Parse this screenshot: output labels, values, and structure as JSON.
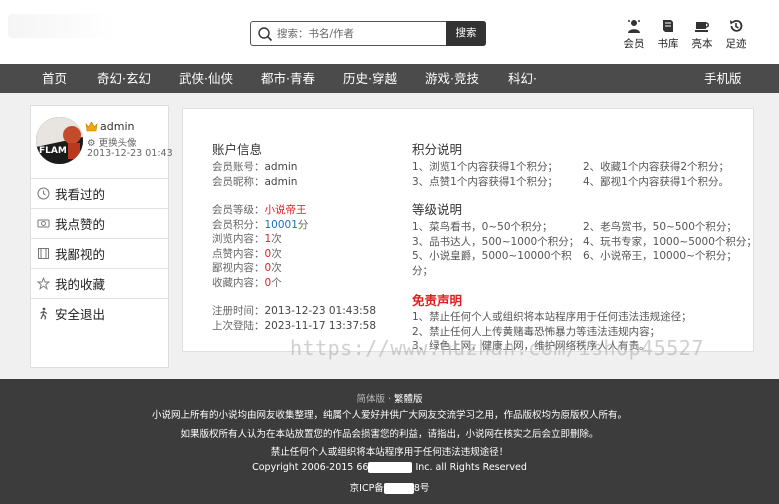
{
  "header": {
    "search": {
      "placeholder": "搜索：书名/作者",
      "button": "搜索"
    },
    "icons": [
      {
        "label": "会员",
        "icon": "member-icon"
      },
      {
        "label": "书库",
        "icon": "book-icon"
      },
      {
        "label": "亮本",
        "icon": "cup-icon"
      },
      {
        "label": "足迹",
        "icon": "history-icon"
      }
    ]
  },
  "nav": {
    "items": [
      "首页",
      "奇幻·玄幻",
      "武侠·仙侠",
      "都市·青春",
      "历史·穿越",
      "游戏·竞技",
      "科幻·"
    ],
    "mobile": "手机版"
  },
  "sidebar": {
    "username": "admin",
    "change_avatar": "更换头像",
    "date": "2013-12-23 01:43",
    "menu": [
      {
        "label": "我看过的",
        "icon": "clock-icon"
      },
      {
        "label": "我点赞的",
        "icon": "like-icon"
      },
      {
        "label": "我鄙视的",
        "icon": "film-icon"
      },
      {
        "label": "我的收藏",
        "icon": "star-icon"
      },
      {
        "label": "安全退出",
        "icon": "exit-icon"
      }
    ]
  },
  "account": {
    "title": "账户信息",
    "account_label": "会员账号：",
    "account_value": "admin",
    "nick_label": "会员昵称：",
    "nick_value": "admin",
    "level_label": "会员等级：",
    "level_value": "小说帝王",
    "points_label": "会员积分：",
    "points_value": "10001",
    "points_unit": "分",
    "browse_label": "浏览内容：",
    "browse_value": "1",
    "browse_unit": "次",
    "like_label": "点赞内容：",
    "like_value": "0",
    "like_unit": "次",
    "despise_label": "鄙视内容：",
    "despise_value": "0",
    "despise_unit": "次",
    "fav_label": "收藏内容：",
    "fav_value": "0",
    "fav_unit": "个",
    "reg_label": "注册时间：",
    "reg_value": "2013-12-23 01:43:58",
    "login_label": "上次登陆：",
    "login_value": "2023-11-17 13:37:58"
  },
  "points_info": {
    "title": "积分说明",
    "items": [
      "1、浏览1个内容获得1个积分；",
      "2、收藏1个内容获得2个积分；",
      "3、点赞1个内容获得1个积分；",
      "4、鄙视1个内容获得1个积分。"
    ]
  },
  "level_info": {
    "title": "等级说明",
    "items": [
      "1、菜鸟看书，0~50个积分；",
      "2、老鸟赏书，50~500个积分；",
      "3、品书达人，500~1000个积分；",
      "4、玩书专家，1000~5000个积分；",
      "5、小说皇爵，5000~10000个积",
      "6、小说帝王，10000~个积分；"
    ],
    "wrap": "分；"
  },
  "disclaimer": {
    "title": "免责声明",
    "lines": [
      "1、禁止任何个人或组织将本站程序用于任何违法违规途径；",
      "2、禁止任何人上传黄赌毒恐怖暴力等违法违规内容；",
      "3、绿色上网，健康上网，维护网络秩序人人有责。"
    ]
  },
  "watermark": "https://www.huzhan.com/ishop45527",
  "footer": {
    "switch_simplified": "简体版",
    "switch_sep": " · ",
    "switch_traditional": "繁體版",
    "line1": "小说网上所有的小说均由网友收集整理，纯属个人爱好并供广大网友交流学习之用，作品版权均为原版权人所有。",
    "line2": "如果版权所有人认为在本站放置您的作品会损害您的利益，请指出，小说网在核实之后会立即删除。",
    "line3": "禁止任何个人或组织将本站程序用于任何违法违规途径！",
    "copyright_pre": "Copyright 2006-2015 66",
    "copyright_post": " Inc. all Rights Reserved",
    "icp_pre": "京ICP备",
    "icp_post": "8号"
  }
}
